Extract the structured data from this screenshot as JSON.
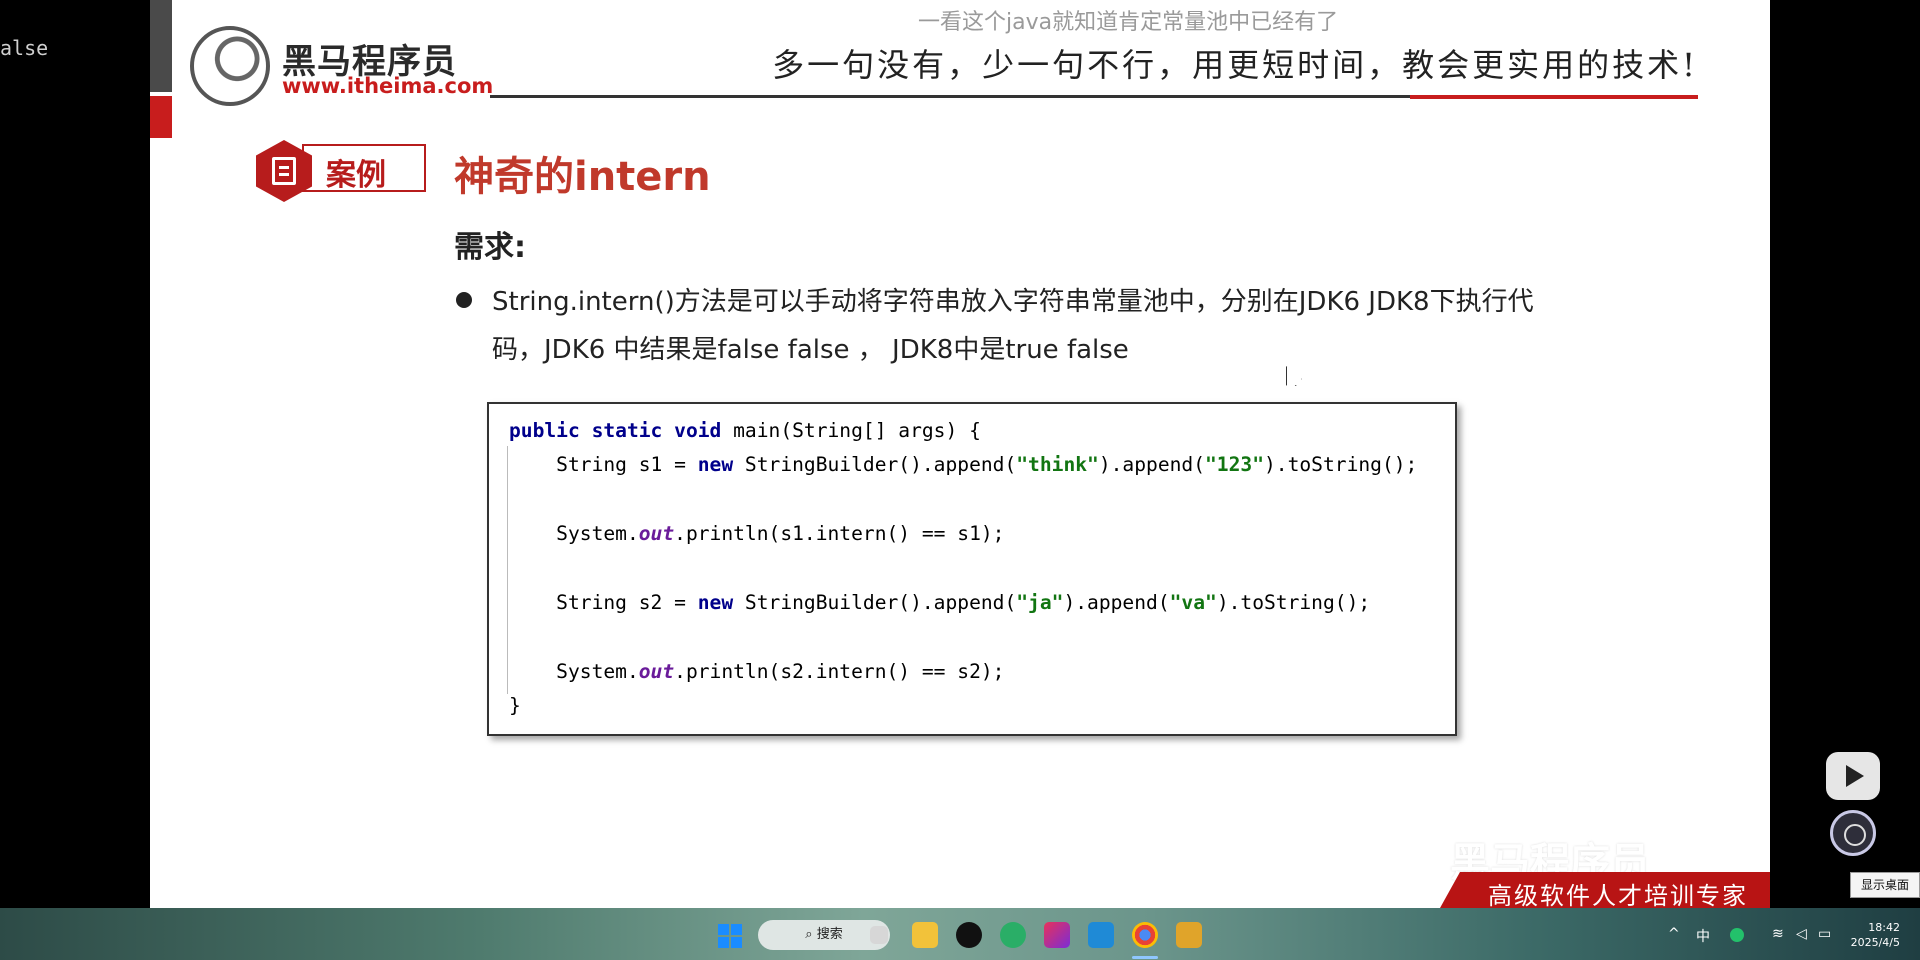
{
  "background": {
    "terminal_text": "alse"
  },
  "slide": {
    "overlay_caption": "一看这个java就知道肯定常量池中已经有了",
    "logo": {
      "name": "黑马程序员",
      "url": "www.itheima.com"
    },
    "slogan": "多一句没有，少一句不行，用更短时间，教会更实用的技术!",
    "case_label": "案例",
    "title": "神奇的intern",
    "requirement_label": "需求:",
    "description": "String.intern()方法是可以手动将字符串放入字符串常量池中，分别在JDK6 JDK8下执行代码，JDK6 中结果是false false ， JDK8中是true false",
    "code_lines": [
      "public static void main(String[] args) {",
      "    String s1 = new StringBuilder().append(\"think\").append(\"123\").toString();",
      "",
      "    System.out.println(s1.intern() == s1);",
      "",
      "    String s2 = new StringBuilder().append(\"ja\").append(\"va\").toString();",
      "",
      "    System.out.println(s2.intern() == s2);",
      "}"
    ],
    "watermark": "黑马程序员 bilibili",
    "footer_text": "高级软件人才培训专家"
  },
  "side": {
    "show_desktop_tooltip": "显示桌面"
  },
  "taskbar": {
    "search_label": "搜索",
    "ime": "中",
    "time": "18:42",
    "date": "2025/4/5"
  },
  "colors": {
    "accent_red": "#c81d1d",
    "title_red": "#c0392b",
    "keyword": "#00008b",
    "string": "#127512"
  }
}
